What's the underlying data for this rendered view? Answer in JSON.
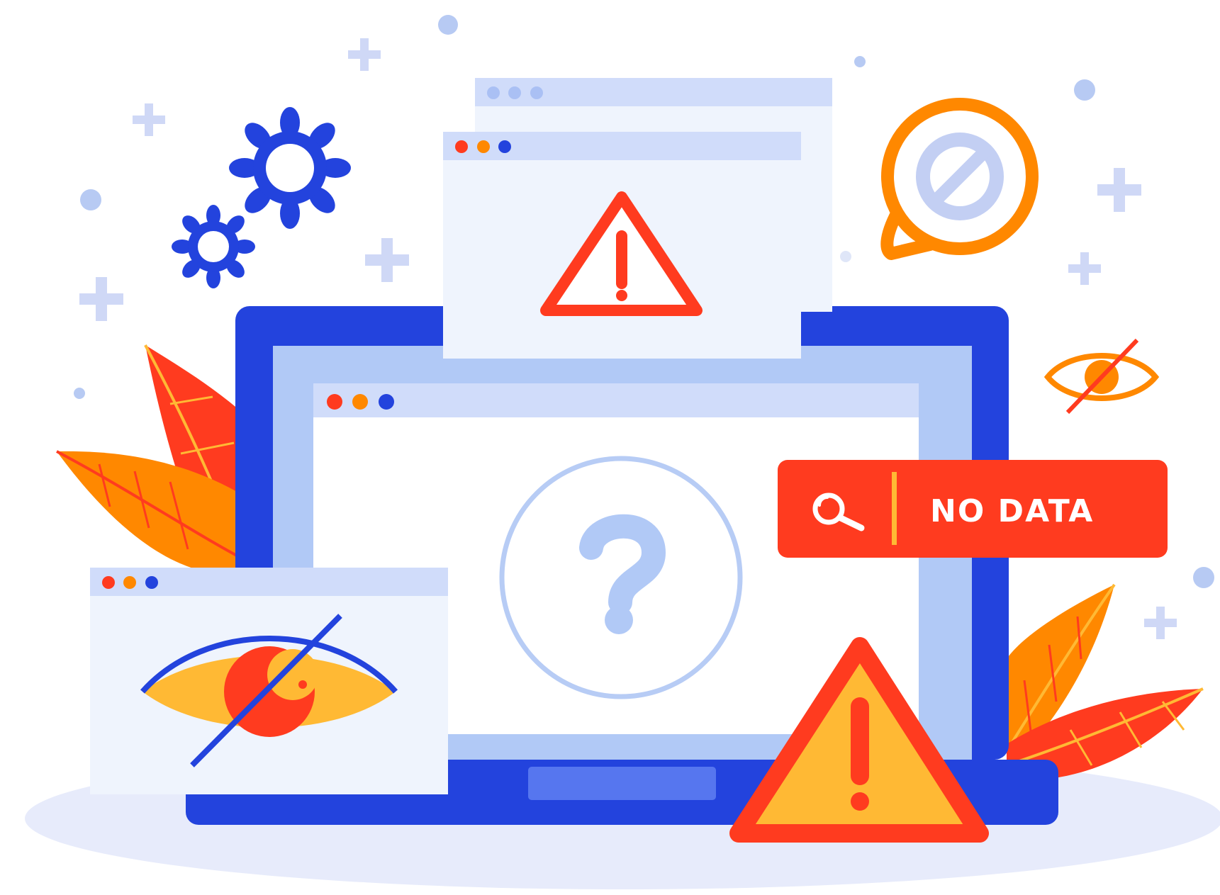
{
  "banner": {
    "label": "NO DATA",
    "icon": "search-icon"
  },
  "palette": {
    "blue": "#2343dd",
    "light_blue": "#b1c9f6",
    "pale_blue": "#d0dcfa",
    "window_bg": "#eff4fd",
    "red": "#ff3b1f",
    "orange": "#ff8800",
    "yellow": "#ffb934",
    "lavender": "#c3cff3"
  },
  "icons": [
    "gear-icon",
    "warning-icon",
    "question-icon",
    "no-symbol-icon",
    "eye-slash-icon",
    "search-icon",
    "leaf-icon",
    "plus-icon"
  ]
}
